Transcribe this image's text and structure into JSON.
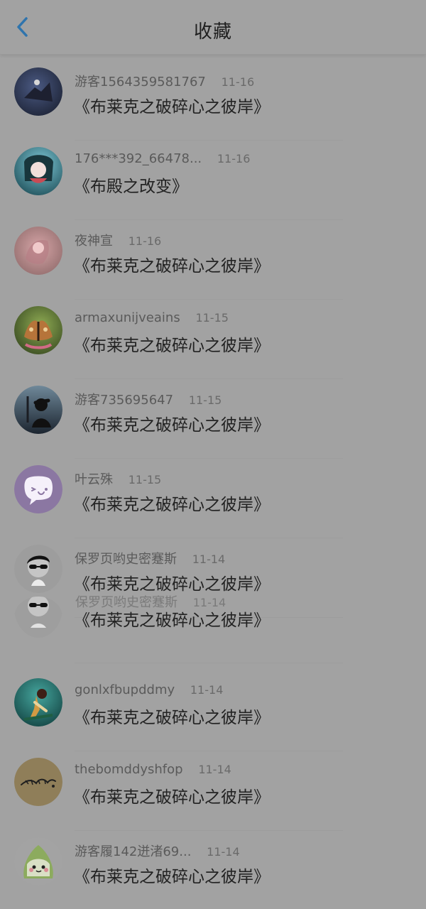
{
  "header": {
    "title": "收藏",
    "back_icon": "chevron-left-icon"
  },
  "items": [
    {
      "name": "游客1564359581767",
      "time": "11-16",
      "book": "《布莱克之破碎心之彼岸》",
      "avatar": "avatar-1"
    },
    {
      "name": "176***392_66478...",
      "time": "11-16",
      "book": "《布殿之改变》",
      "avatar": "avatar-2"
    },
    {
      "name": "夜神宣",
      "time": "11-16",
      "book": "《布莱克之破碎心之彼岸》",
      "avatar": "avatar-3"
    },
    {
      "name": "armaxunijveains",
      "time": "11-15",
      "book": "《布莱克之破碎心之彼岸》",
      "avatar": "avatar-4"
    },
    {
      "name": "游客735695647",
      "time": "11-15",
      "book": "《布莱克之破碎心之彼岸》",
      "avatar": "avatar-5"
    },
    {
      "name": "叶云殊",
      "time": "11-15",
      "book": "《布莱克之破碎心之彼岸》",
      "avatar": "avatar-6"
    },
    {
      "name": "保罗页哟史密蹇斯",
      "time": "11-14",
      "book": "《布莱克之破碎心之彼岸》",
      "avatar": "avatar-7"
    },
    {
      "name": "保罗页哟史密蹇斯",
      "time": "11-14",
      "book": "《布莱克之破碎心之彼岸》",
      "avatar": "avatar-8"
    },
    {
      "name": "gonlxfbupddmy",
      "time": "11-14",
      "book": "《布莱克之破碎心之彼岸》",
      "avatar": "avatar-9"
    },
    {
      "name": "thebomddyshfop",
      "time": "11-14",
      "book": "《布莱克之破碎心之彼岸》",
      "avatar": "avatar-10"
    },
    {
      "name": "游客履142迸渚69...",
      "time": "11-14",
      "book": "《布莱克之破碎心之彼岸》",
      "avatar": "avatar-11"
    }
  ]
}
